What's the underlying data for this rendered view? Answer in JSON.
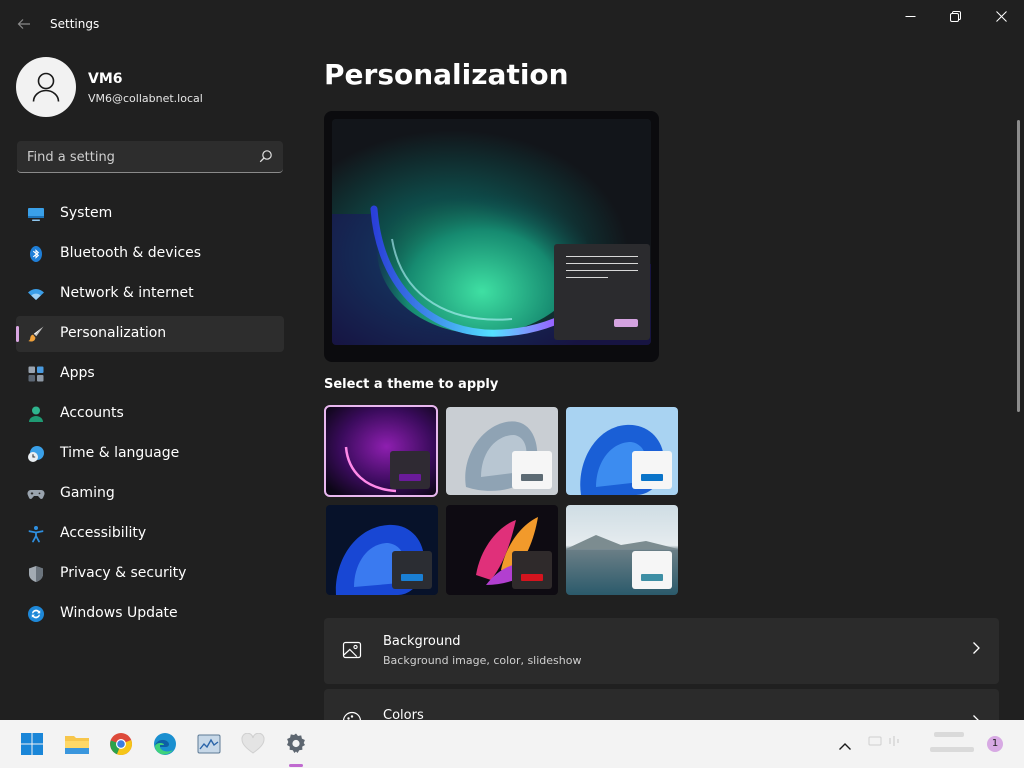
{
  "app": {
    "title": "Settings"
  },
  "window_controls": {
    "minimize": "minimize",
    "maximize": "restore",
    "close": "close"
  },
  "profile": {
    "name": "VM6",
    "email": "VM6@collabnet.local"
  },
  "search": {
    "placeholder": "Find a setting"
  },
  "sidebar": {
    "items": [
      {
        "label": "System",
        "icon": "monitor-icon"
      },
      {
        "label": "Bluetooth & devices",
        "icon": "bluetooth-icon"
      },
      {
        "label": "Network & internet",
        "icon": "wifi-icon"
      },
      {
        "label": "Personalization",
        "icon": "brush-icon",
        "active": true
      },
      {
        "label": "Apps",
        "icon": "apps-icon"
      },
      {
        "label": "Accounts",
        "icon": "person-icon"
      },
      {
        "label": "Time & language",
        "icon": "clock-globe-icon"
      },
      {
        "label": "Gaming",
        "icon": "gamepad-icon"
      },
      {
        "label": "Accessibility",
        "icon": "accessibility-icon"
      },
      {
        "label": "Privacy & security",
        "icon": "shield-icon"
      },
      {
        "label": "Windows Update",
        "icon": "update-icon"
      }
    ]
  },
  "main": {
    "title": "Personalization",
    "theme_section_label": "Select a theme to apply",
    "themes": [
      {
        "name": "dark-purple-theme",
        "selected": true,
        "accent": "#6a1b9a"
      },
      {
        "name": "light-grey-bloom-theme",
        "selected": false,
        "accent": "#5d6b74"
      },
      {
        "name": "light-blue-bloom-theme",
        "selected": false,
        "accent": "#0a74c9"
      },
      {
        "name": "dark-blue-bloom-theme",
        "selected": false,
        "accent": "#1a7fd4"
      },
      {
        "name": "dark-flower-theme",
        "selected": false,
        "accent": "#d4141e"
      },
      {
        "name": "landscape-lake-theme",
        "selected": false,
        "accent": "#3e8fa5"
      }
    ],
    "cards": [
      {
        "title": "Background",
        "subtitle": "Background image, color, slideshow",
        "icon": "picture-icon"
      },
      {
        "title": "Colors",
        "subtitle": "",
        "icon": "palette-icon"
      }
    ]
  },
  "taskbar": {
    "items": [
      "start-icon",
      "file-explorer-icon",
      "chrome-icon",
      "edge-icon",
      "resource-monitor-icon",
      "heart-app-icon",
      "settings-icon"
    ],
    "notification_count": "1"
  },
  "colors": {
    "accent": "#d9a6e2",
    "window_bg": "#202020",
    "card_bg": "#2b2b2b",
    "taskbar_bg": "#f3f3f3"
  }
}
